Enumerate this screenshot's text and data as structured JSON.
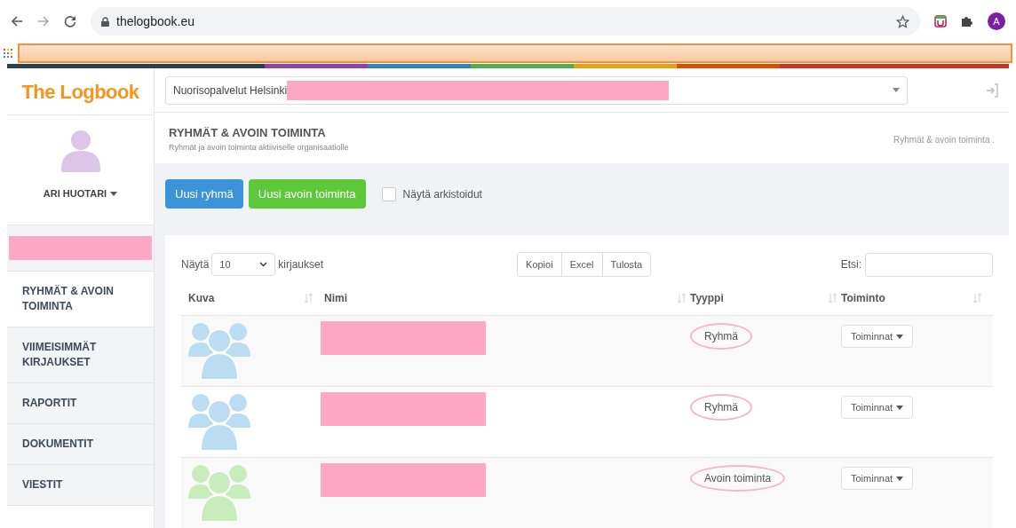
{
  "browser": {
    "url": "thelogbook.eu",
    "profile_initial": "A"
  },
  "app": {
    "logo": "The Logbook",
    "organization": "Nuorisopalvelut Helsinki"
  },
  "user": {
    "name": "ARI HUOTARI"
  },
  "sidebar": {
    "items": [
      {
        "label": "RYHMÄT & AVOIN TOIMINTA",
        "selected": true
      },
      {
        "label": "VIIMEISIMMÄT KIRJAUKSET",
        "selected": false
      },
      {
        "label": "RAPORTIT",
        "selected": false
      },
      {
        "label": "DOKUMENTIT",
        "selected": false
      },
      {
        "label": "VIESTIT",
        "selected": false
      }
    ]
  },
  "page": {
    "title": "RYHMÄT & AVOIN TOIMINTA",
    "subtitle": "Ryhmät ja avoin toiminta aktiiviselle organisaatiolle",
    "breadcrumb": "Ryhmät & avoin toiminta ."
  },
  "actions": {
    "buttons": [
      {
        "label": "Uusi ryhmä",
        "color": "#3b93d9"
      },
      {
        "label": "Uusi avoin toiminta",
        "color": "#5cc83a"
      }
    ],
    "archived": {
      "label": "Näytä arkistoidut",
      "checked": false
    }
  },
  "table": {
    "show_label": "Näytä",
    "page_size": "10",
    "entries_label": "kirjaukset",
    "export_buttons": [
      "Kopioi",
      "Excel",
      "Tulosta"
    ],
    "search_label": "Etsi:",
    "columns": [
      "Kuva",
      "Nimi",
      "Tyyppi",
      "Toiminto"
    ],
    "rows": [
      {
        "color": "#bcdcf2",
        "type": "Ryhmä",
        "action": "Toiminnat"
      },
      {
        "color": "#bcdcf2",
        "type": "Ryhmä",
        "action": "Toiminnat"
      },
      {
        "color": "#c8ecbc",
        "type": "Avoin toiminta",
        "action": "Toiminnat"
      }
    ]
  }
}
